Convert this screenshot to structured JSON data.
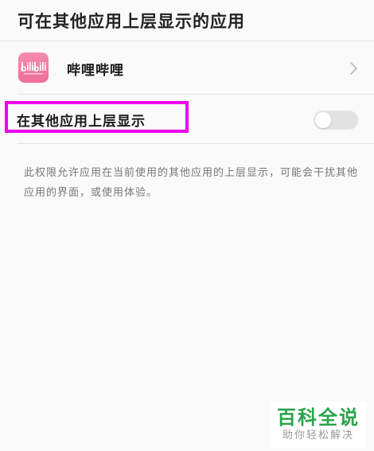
{
  "header": {
    "title": "可在其他应用上层显示的应用"
  },
  "app": {
    "name": "哔哩哔哩",
    "icon": "bilibili-app-icon",
    "icon_color": "#f07aa3"
  },
  "setting": {
    "label": "在其他应用上层显示",
    "enabled": false,
    "highlight_color": "#ee00ee"
  },
  "description": {
    "text": "此权限允许应用在当前使用的其他应用的上层显示，可能会干扰其他应用的界面，或使用体验。"
  },
  "watermark": {
    "main": "百科全说",
    "sub": "助你轻松解决",
    "color": "#2aa44a"
  }
}
